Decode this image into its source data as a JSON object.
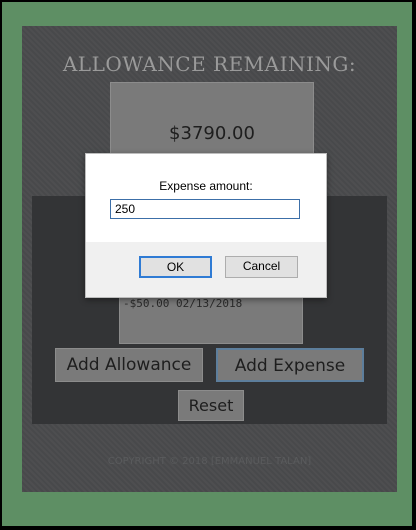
{
  "app": {
    "title": "ALLOWANCE REMAINING:",
    "balance": "$3790.00",
    "history": [
      "-$50.00 02/13/2018"
    ],
    "buttons": {
      "add_allowance": "Add Allowance",
      "add_expense": "Add Expense",
      "reset": "Reset"
    },
    "copyright": "COPYRIGHT © 2018 [EMMANUEL TALAN]"
  },
  "dialog": {
    "label": "Expense amount:",
    "input_value": "250",
    "ok_label": "OK",
    "cancel_label": "Cancel"
  },
  "colors": {
    "frame": "#5e8f64",
    "panel": "#4a4b4d",
    "box": "#7a7a7a",
    "accent": "#2f7bd4"
  }
}
